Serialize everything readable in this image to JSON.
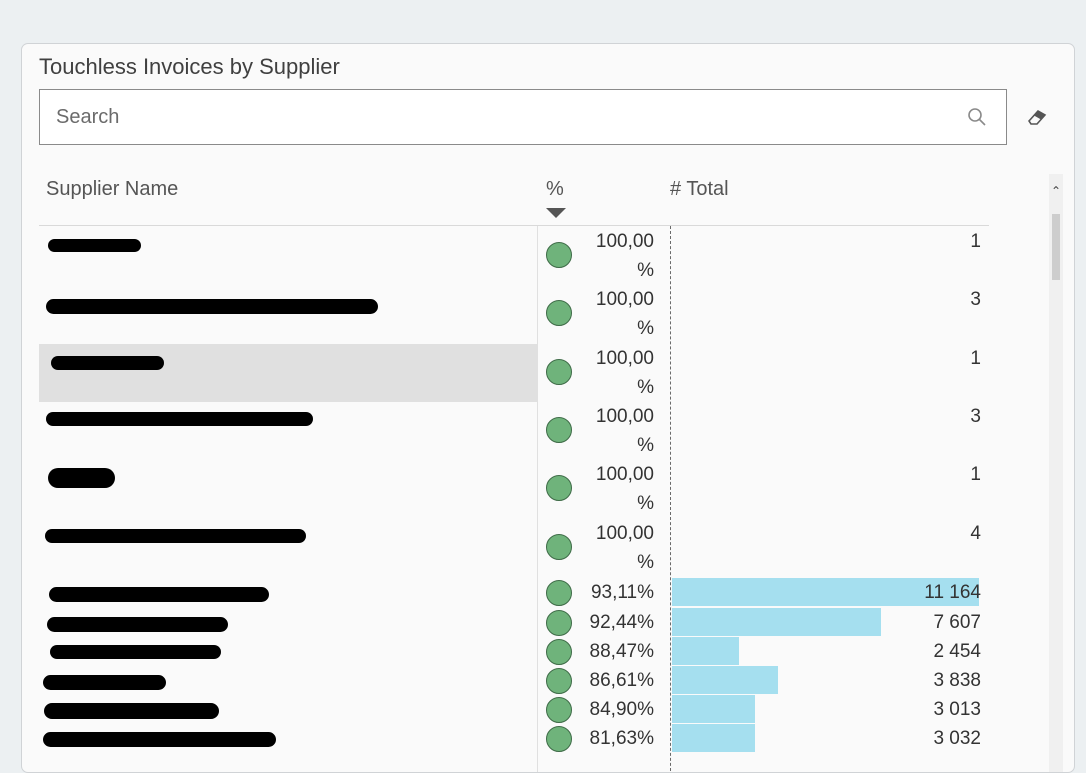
{
  "visual": {
    "title": "Touchless Invoices by Supplier",
    "search_placeholder": "Search",
    "icons": {
      "search": "search-icon",
      "eraser": "eraser-icon",
      "sort": "sort-descending-icon",
      "status": "green-circle-icon"
    },
    "colors": {
      "status_green": "#6fb37b",
      "bar": "#a5dfef"
    },
    "columns": {
      "supplier": "Supplier Name",
      "percent": "%",
      "total": "# Total"
    }
  },
  "rows": [
    {
      "pct1": "100,00",
      "pct2": "%",
      "total": "1",
      "total_value": 1,
      "selected": false
    },
    {
      "pct1": "100,00",
      "pct2": "%",
      "total": "3",
      "total_value": 3,
      "selected": false
    },
    {
      "pct1": "100,00",
      "pct2": "%",
      "total": "1",
      "total_value": 1,
      "selected": true
    },
    {
      "pct1": "100,00",
      "pct2": "%",
      "total": "3",
      "total_value": 3,
      "selected": false
    },
    {
      "pct1": "100,00",
      "pct2": "%",
      "total": "1",
      "total_value": 1,
      "selected": false
    },
    {
      "pct1": "100,00",
      "pct2": "%",
      "total": "4",
      "total_value": 4,
      "selected": false
    },
    {
      "pct": "93,11%",
      "total": "11 164",
      "total_value": 11164,
      "selected": false
    },
    {
      "pct": "92,44%",
      "total": "7 607",
      "total_value": 7607,
      "selected": false
    },
    {
      "pct": "88,47%",
      "total": "2 454",
      "total_value": 2454,
      "selected": false
    },
    {
      "pct": "86,61%",
      "total": "3 838",
      "total_value": 3838,
      "selected": false
    },
    {
      "pct": "84,90%",
      "total": "3 013",
      "total_value": 3013,
      "selected": false
    },
    {
      "pct": "81,63%",
      "total": "3 032",
      "total_value": 3032,
      "selected": false
    }
  ]
}
